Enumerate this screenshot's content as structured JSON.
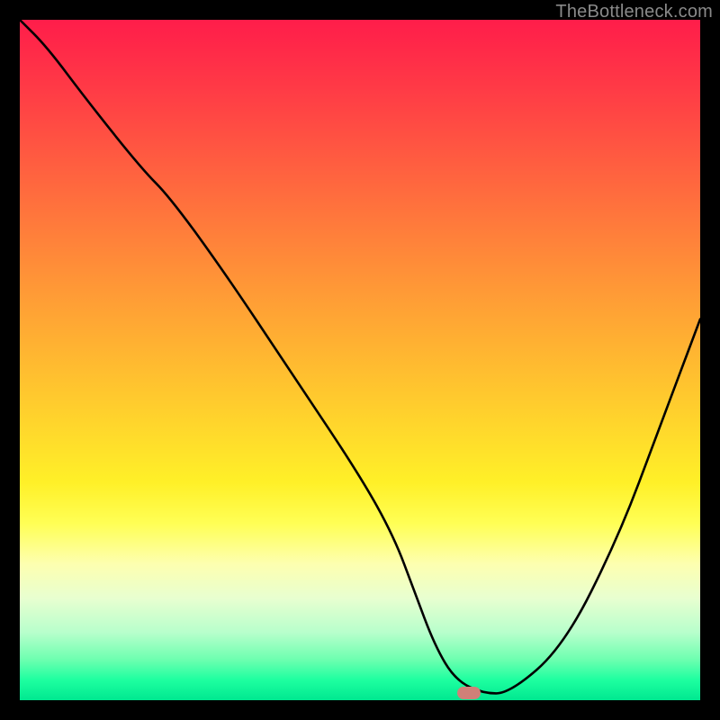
{
  "watermark": "TheBottleneck.com",
  "colors": {
    "background": "#000000",
    "curve": "#000000",
    "marker": "#d08078"
  },
  "chart_data": {
    "type": "line",
    "title": "",
    "xlabel": "",
    "ylabel": "",
    "xlim": [
      0,
      100
    ],
    "ylim": [
      0,
      100
    ],
    "grid": false,
    "legend": false,
    "series": [
      {
        "name": "bottleneck-curve",
        "x": [
          0,
          4,
          10,
          18,
          22,
          30,
          40,
          50,
          55,
          58,
          61,
          64,
          68,
          72,
          80,
          88,
          94,
          100
        ],
        "values": [
          100,
          96,
          88,
          78,
          74,
          63,
          48,
          33,
          24,
          16,
          8,
          3,
          1,
          1,
          8,
          24,
          40,
          56
        ]
      }
    ],
    "marker": {
      "x": 66,
      "y": 1
    }
  }
}
